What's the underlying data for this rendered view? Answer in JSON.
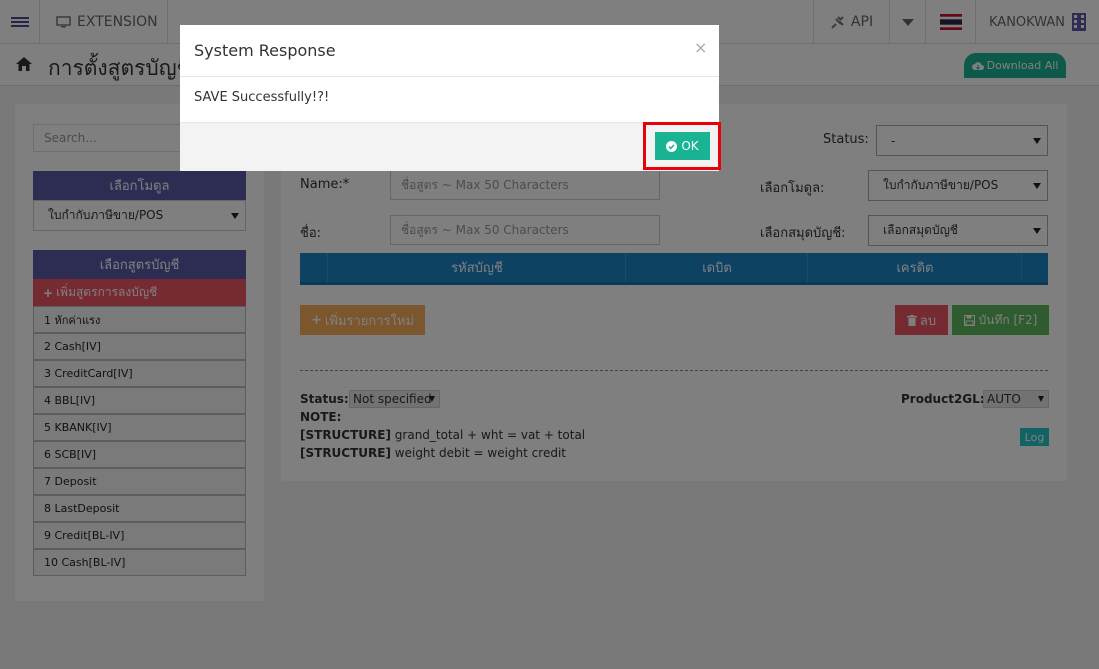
{
  "topbar": {
    "extension_label": "EXTENSION",
    "api_label": "API",
    "user_name": "KANOKWAN"
  },
  "page": {
    "title": "การตั้งสูตรบัญชี",
    "download_label": "Download All"
  },
  "sidebar": {
    "search_placeholder": "Search...",
    "module_header": "เลือกโมดูล",
    "module_selected": "ใบกำกับภาษีขาย/POS",
    "formula_header": "เลือกสูตรบัญชี",
    "add_formula_label": "เพิ่มสูตรการลงบัญชี",
    "items": [
      {
        "label": "1 หักค่าแรง"
      },
      {
        "label": "2 Cash[IV]"
      },
      {
        "label": "3 CreditCard[IV]"
      },
      {
        "label": "4 BBL[IV]"
      },
      {
        "label": "5 KBANK[IV]"
      },
      {
        "label": "6 SCB[IV]"
      },
      {
        "label": "7 Deposit"
      },
      {
        "label": "8 LastDeposit"
      },
      {
        "label": "9 Credit[BL-IV]"
      },
      {
        "label": "10 Cash[BL-IV]"
      }
    ]
  },
  "form": {
    "status_label": "Status:",
    "status_value": "-",
    "name_label": "Name:*",
    "name_placeholder": "ชื่อสูตร ~ Max 50 Characters",
    "thai_name_label": "ชื่อ:",
    "thai_name_placeholder": "ชื่อสูตร ~ Max 50 Characters",
    "module_label": "เลือกโมดูล:",
    "module_value": "ใบกำกับภาษีขาย/POS",
    "book_label": "เลือกสมุดบัญชี:",
    "book_value": "เลือกสมุดบัญชี"
  },
  "table": {
    "columns": [
      "รหัสบัญชี",
      "เดบิต",
      "เครดิต"
    ]
  },
  "actions": {
    "add_row": "เพิ่มรายการใหม่",
    "delete": "ลบ",
    "save": "บันทึก [F2]"
  },
  "footer": {
    "status_label": "Status:",
    "status_value": "Not specified",
    "product2gl_label": "Product2GL:",
    "product2gl_value": "AUTO",
    "note_label": "NOTE:",
    "structure_tag": "[STRUCTURE]",
    "structure1": " grand_total + wht = vat + total",
    "structure2": " weight debit = weight credit",
    "log_label": "Log"
  },
  "modal": {
    "title": "System Response",
    "close": "×",
    "message": "SAVE Successfully!?!",
    "ok_label": "OK"
  },
  "colors": {
    "primary": "#1ab394",
    "purple": "#5b5aa8",
    "danger": "#ed5565",
    "blue": "#1c84c6",
    "warning": "#f8ac59",
    "success": "#5cb85c",
    "highlight": "#e8000b"
  }
}
